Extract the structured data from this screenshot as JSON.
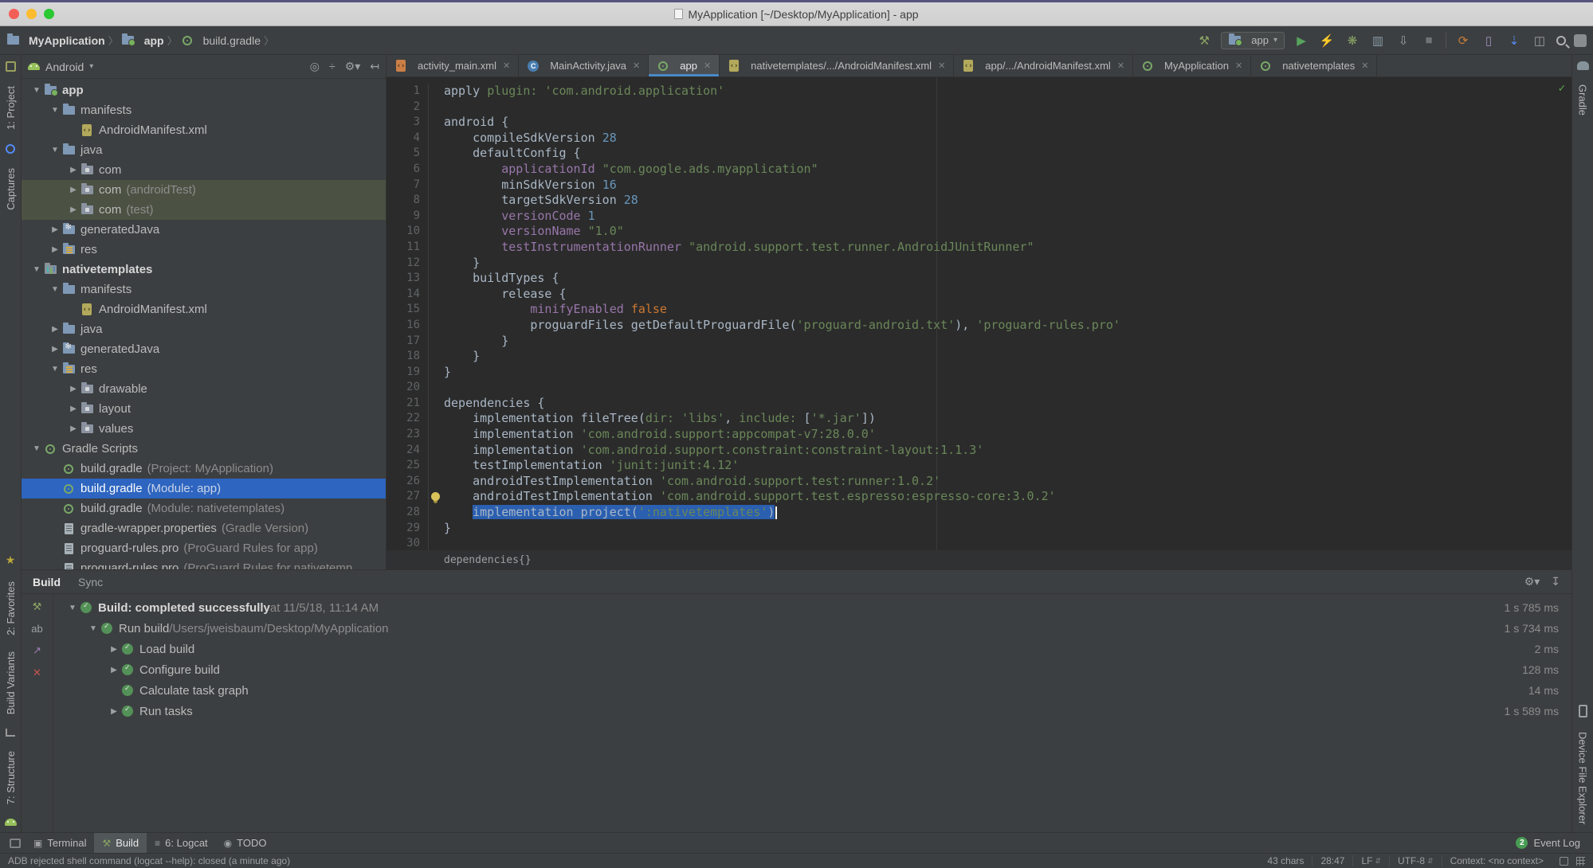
{
  "window": {
    "title": "MyApplication [~/Desktop/MyApplication] - app"
  },
  "breadcrumbs": {
    "items": [
      {
        "label": "MyApplication",
        "icon": "folder-icon",
        "bold": true
      },
      {
        "label": "app",
        "icon": "module-folder-icon",
        "bold": true
      },
      {
        "label": "build.gradle",
        "icon": "gradle-icon",
        "bold": false
      }
    ]
  },
  "toolbar": {
    "run_config": "app",
    "icons_left": [
      {
        "name": "build-hammer-icon",
        "glyph": "⚒",
        "color": "#8aa363"
      }
    ],
    "icons_run": [
      {
        "name": "run-icon",
        "glyph": "▶",
        "color": "#57a35c"
      },
      {
        "name": "apply-changes-icon",
        "glyph": "⚡",
        "color": "#a5a87b"
      },
      {
        "name": "debug-icon",
        "glyph": "❋",
        "color": "#8aa363"
      },
      {
        "name": "profiler-icon",
        "glyph": "▥",
        "color": "#8a9ba8"
      },
      {
        "name": "attach-debugger-icon",
        "glyph": "⇩",
        "color": "#9da0a2"
      },
      {
        "name": "stop-icon",
        "glyph": "■",
        "color": "#6f7375"
      }
    ],
    "icons_tools": [
      {
        "name": "sync-gradle-icon",
        "glyph": "⟳",
        "color": "#c77d3b"
      },
      {
        "name": "avd-manager-icon",
        "glyph": "▯",
        "color": "#9d8fc2"
      },
      {
        "name": "sdk-manager-icon",
        "glyph": "⇣",
        "color": "#548af7"
      },
      {
        "name": "layout-inspector-icon",
        "glyph": "◫",
        "color": "#9da0a2"
      }
    ]
  },
  "left_strip": {
    "top": [
      {
        "name": "tool-project",
        "label": "1: Project",
        "icon": "project-icon"
      },
      {
        "name": "tool-captures",
        "label": "Captures",
        "icon": "captures-icon"
      }
    ],
    "bottom": [
      {
        "name": "tool-favorites",
        "label": "2: Favorites",
        "icon": "star-icon"
      },
      {
        "name": "tool-build-variants",
        "label": "Build Variants",
        "icon": ""
      },
      {
        "name": "tool-structure",
        "label": "7: Structure",
        "icon": "structure-icon"
      }
    ]
  },
  "right_strip": {
    "top": [
      {
        "name": "tool-gradle",
        "label": "Gradle",
        "icon": "gradle-elephant-icon"
      }
    ],
    "bottom": [
      {
        "name": "tool-device-file-explorer",
        "label": "Device File Explorer",
        "icon": "device-icon"
      }
    ]
  },
  "project_panel": {
    "mode": "Android",
    "header_icons": [
      {
        "name": "locate-icon",
        "glyph": "◎"
      },
      {
        "name": "collapse-all-icon",
        "glyph": "÷"
      },
      {
        "name": "view-options-icon",
        "glyph": "⚙▾"
      },
      {
        "name": "hide-panel-icon",
        "glyph": "↤"
      }
    ],
    "tree": [
      {
        "depth": 0,
        "arrow": "open",
        "icon": "module-folder",
        "label": "app",
        "suffix": "",
        "bold": true
      },
      {
        "depth": 1,
        "arrow": "open",
        "icon": "folder",
        "label": "manifests",
        "suffix": ""
      },
      {
        "depth": 2,
        "arrow": "none",
        "icon": "xml-file",
        "label": "AndroidManifest.xml",
        "suffix": ""
      },
      {
        "depth": 1,
        "arrow": "open",
        "icon": "folder",
        "label": "java",
        "suffix": ""
      },
      {
        "depth": 2,
        "arrow": "closed",
        "icon": "package-folder",
        "label": "com",
        "suffix": ""
      },
      {
        "depth": 2,
        "arrow": "closed",
        "icon": "package-folder",
        "label": "com",
        "suffix": "(androidTest)",
        "band": true
      },
      {
        "depth": 2,
        "arrow": "closed",
        "icon": "package-folder",
        "label": "com",
        "suffix": "(test)",
        "band": true
      },
      {
        "depth": 1,
        "arrow": "closed",
        "icon": "gen-folder",
        "label": "generatedJava",
        "suffix": ""
      },
      {
        "depth": 1,
        "arrow": "closed",
        "icon": "res-folder",
        "label": "res",
        "suffix": ""
      },
      {
        "depth": 0,
        "arrow": "open",
        "icon": "lib-module",
        "label": "nativetemplates",
        "suffix": "",
        "bold": true
      },
      {
        "depth": 1,
        "arrow": "open",
        "icon": "folder",
        "label": "manifests",
        "suffix": ""
      },
      {
        "depth": 2,
        "arrow": "none",
        "icon": "xml-file",
        "label": "AndroidManifest.xml",
        "suffix": ""
      },
      {
        "depth": 1,
        "arrow": "closed",
        "icon": "folder",
        "label": "java",
        "suffix": ""
      },
      {
        "depth": 1,
        "arrow": "closed",
        "icon": "gen-folder",
        "label": "generatedJava",
        "suffix": ""
      },
      {
        "depth": 1,
        "arrow": "open",
        "icon": "res-folder",
        "label": "res",
        "suffix": ""
      },
      {
        "depth": 2,
        "arrow": "closed",
        "icon": "package-folder",
        "label": "drawable",
        "suffix": ""
      },
      {
        "depth": 2,
        "arrow": "closed",
        "icon": "package-folder",
        "label": "layout",
        "suffix": ""
      },
      {
        "depth": 2,
        "arrow": "closed",
        "icon": "package-folder",
        "label": "values",
        "suffix": ""
      },
      {
        "depth": 0,
        "arrow": "open",
        "icon": "gradle",
        "label": "Gradle Scripts",
        "suffix": ""
      },
      {
        "depth": 1,
        "arrow": "none",
        "icon": "gradle",
        "label": "build.gradle",
        "suffix": "(Project: MyApplication)"
      },
      {
        "depth": 1,
        "arrow": "none",
        "icon": "gradle",
        "label": "build.gradle",
        "suffix": "(Module: app)",
        "selected": true
      },
      {
        "depth": 1,
        "arrow": "none",
        "icon": "gradle",
        "label": "build.gradle",
        "suffix": "(Module: nativetemplates)"
      },
      {
        "depth": 1,
        "arrow": "none",
        "icon": "file",
        "label": "gradle-wrapper.properties",
        "suffix": "(Gradle Version)"
      },
      {
        "depth": 1,
        "arrow": "none",
        "icon": "file",
        "label": "proguard-rules.pro",
        "suffix": "(ProGuard Rules for app)"
      },
      {
        "depth": 1,
        "arrow": "none",
        "icon": "file",
        "label": "proguard-rules.pro",
        "suffix": "(ProGuard Rules for nativetemp"
      }
    ]
  },
  "tabs": [
    {
      "label": "activity_main.xml",
      "icon": "layout-xml"
    },
    {
      "label": "MainActivity.java",
      "icon": "java-class"
    },
    {
      "label": "app",
      "icon": "gradle",
      "selected": true
    },
    {
      "label": "nativetemplates/.../AndroidManifest.xml",
      "icon": "xml-file"
    },
    {
      "label": "app/.../AndroidManifest.xml",
      "icon": "xml-file"
    },
    {
      "label": "MyApplication",
      "icon": "gradle"
    },
    {
      "label": "nativetemplates",
      "icon": "gradle"
    }
  ],
  "editor": {
    "breadcrumb": "dependencies{}",
    "lines": [
      {
        "n": 1,
        "segs": [
          [
            "d",
            "apply "
          ],
          [
            "s",
            "plugin:"
          ],
          [
            "d",
            " "
          ],
          [
            "s",
            "'com.android.application'"
          ]
        ]
      },
      {
        "n": 2,
        "segs": []
      },
      {
        "n": 3,
        "segs": [
          [
            "d",
            "android {"
          ]
        ]
      },
      {
        "n": 4,
        "segs": [
          [
            "d",
            "    compileSdkVersion "
          ],
          [
            "n",
            "28"
          ]
        ]
      },
      {
        "n": 5,
        "segs": [
          [
            "d",
            "    defaultConfig {"
          ]
        ]
      },
      {
        "n": 6,
        "segs": [
          [
            "d",
            "        "
          ],
          [
            "p",
            "applicationId"
          ],
          [
            "d",
            " "
          ],
          [
            "s",
            "\"com.google.ads.myapplication\""
          ]
        ]
      },
      {
        "n": 7,
        "segs": [
          [
            "d",
            "        minSdkVersion "
          ],
          [
            "n",
            "16"
          ]
        ]
      },
      {
        "n": 8,
        "segs": [
          [
            "d",
            "        targetSdkVersion "
          ],
          [
            "n",
            "28"
          ]
        ]
      },
      {
        "n": 9,
        "segs": [
          [
            "d",
            "        "
          ],
          [
            "p",
            "versionCode"
          ],
          [
            "d",
            " "
          ],
          [
            "n",
            "1"
          ]
        ]
      },
      {
        "n": 10,
        "segs": [
          [
            "d",
            "        "
          ],
          [
            "p",
            "versionName"
          ],
          [
            "d",
            " "
          ],
          [
            "s",
            "\"1.0\""
          ]
        ]
      },
      {
        "n": 11,
        "segs": [
          [
            "d",
            "        "
          ],
          [
            "p",
            "testInstrumentationRunner"
          ],
          [
            "d",
            " "
          ],
          [
            "s",
            "\"android.support.test.runner.AndroidJUnitRunner\""
          ]
        ]
      },
      {
        "n": 12,
        "segs": [
          [
            "d",
            "    }"
          ]
        ]
      },
      {
        "n": 13,
        "segs": [
          [
            "d",
            "    buildTypes {"
          ]
        ]
      },
      {
        "n": 14,
        "segs": [
          [
            "d",
            "        release {"
          ]
        ]
      },
      {
        "n": 15,
        "segs": [
          [
            "d",
            "            "
          ],
          [
            "p",
            "minifyEnabled"
          ],
          [
            "d",
            " "
          ],
          [
            "k",
            "false"
          ]
        ]
      },
      {
        "n": 16,
        "segs": [
          [
            "d",
            "            proguardFiles getDefaultProguardFile("
          ],
          [
            "s",
            "'proguard-android.txt'"
          ],
          [
            "d",
            "), "
          ],
          [
            "s",
            "'proguard-rules.pro'"
          ]
        ]
      },
      {
        "n": 17,
        "segs": [
          [
            "d",
            "        }"
          ]
        ]
      },
      {
        "n": 18,
        "segs": [
          [
            "d",
            "    }"
          ]
        ]
      },
      {
        "n": 19,
        "segs": [
          [
            "d",
            "}"
          ]
        ]
      },
      {
        "n": 20,
        "segs": []
      },
      {
        "n": 21,
        "segs": [
          [
            "d",
            "dependencies {"
          ]
        ]
      },
      {
        "n": 22,
        "segs": [
          [
            "d",
            "    implementation fileTree("
          ],
          [
            "s",
            "dir:"
          ],
          [
            "d",
            " "
          ],
          [
            "s",
            "'libs'"
          ],
          [
            "d",
            ", "
          ],
          [
            "s",
            "include:"
          ],
          [
            "d",
            " ["
          ],
          [
            "s",
            "'*.jar'"
          ],
          [
            "d",
            "])"
          ]
        ]
      },
      {
        "n": 23,
        "segs": [
          [
            "d",
            "    implementation "
          ],
          [
            "s",
            "'com.android.support:appcompat-v7:28.0.0'"
          ]
        ]
      },
      {
        "n": 24,
        "segs": [
          [
            "d",
            "    implementation "
          ],
          [
            "s",
            "'com.android.support.constraint:constraint-layout:1.1.3'"
          ]
        ]
      },
      {
        "n": 25,
        "segs": [
          [
            "d",
            "    testImplementation "
          ],
          [
            "s",
            "'junit:junit:4.12'"
          ]
        ]
      },
      {
        "n": 26,
        "segs": [
          [
            "d",
            "    androidTestImplementation "
          ],
          [
            "s",
            "'com.android.support.test:runner:1.0.2'"
          ]
        ]
      },
      {
        "n": 27,
        "segs": [
          [
            "d",
            "    androidTestImplementation "
          ],
          [
            "s",
            "'com.android.support.test.espresso:espresso-core:3.0.2'"
          ]
        ],
        "bulb": true
      },
      {
        "n": 28,
        "segs": [
          [
            "d",
            "    "
          ]
        ],
        "sel": [
          [
            "d",
            "implementation project("
          ],
          [
            "s",
            "':nativetemplates'"
          ],
          [
            "d",
            ")"
          ]
        ],
        "cursor": true
      },
      {
        "n": 29,
        "segs": [
          [
            "d",
            "}"
          ]
        ]
      },
      {
        "n": 30,
        "segs": []
      }
    ]
  },
  "build_panel": {
    "tabs": [
      {
        "label": "Build",
        "selected": true
      },
      {
        "label": "Sync",
        "selected": false
      }
    ],
    "header_icons": [
      {
        "name": "build-settings-icon",
        "glyph": "⚙▾"
      },
      {
        "name": "collapse-panel-icon",
        "glyph": "↧"
      }
    ],
    "toolbar_icons": [
      {
        "name": "restart-build-icon",
        "glyph": "⚒",
        "color": "#8aa363"
      },
      {
        "name": "filter-text-icon",
        "glyph": "ab",
        "color": "#9da0a2"
      },
      {
        "name": "export-icon",
        "glyph": "↗",
        "color": "#9b7cb6"
      },
      {
        "name": "close-icon",
        "glyph": "✕",
        "color": "#c75450"
      }
    ],
    "rows": [
      {
        "depth": 0,
        "arrow": "open",
        "parts": [
          [
            "b",
            "Build: completed successfully"
          ],
          [
            "g",
            " at 11/5/18, 11:14 AM"
          ]
        ],
        "time": "1 s 785 ms"
      },
      {
        "depth": 1,
        "arrow": "open",
        "parts": [
          [
            "w",
            "Run build "
          ],
          [
            "g",
            "/Users/jweisbaum/Desktop/MyApplication"
          ]
        ],
        "time": "1 s 734 ms"
      },
      {
        "depth": 2,
        "arrow": "closed",
        "parts": [
          [
            "w",
            "Load build"
          ]
        ],
        "time": "2 ms"
      },
      {
        "depth": 2,
        "arrow": "closed",
        "parts": [
          [
            "w",
            "Configure build"
          ]
        ],
        "time": "128 ms"
      },
      {
        "depth": 2,
        "arrow": "none",
        "parts": [
          [
            "w",
            "Calculate task graph"
          ]
        ],
        "time": "14 ms"
      },
      {
        "depth": 2,
        "arrow": "closed",
        "parts": [
          [
            "w",
            "Run tasks"
          ]
        ],
        "time": "1 s 589 ms"
      }
    ]
  },
  "bottom_bar": {
    "items": [
      {
        "label": "Terminal",
        "icon": "terminal-icon",
        "selected": false
      },
      {
        "label": "Build",
        "icon": "hammer-icon",
        "selected": true
      },
      {
        "label": "6: Logcat",
        "icon": "logcat-icon",
        "selected": false
      },
      {
        "label": "TODO",
        "icon": "todo-icon",
        "selected": false
      }
    ],
    "event_log": {
      "badge": "2",
      "label": "Event Log"
    }
  },
  "status_bar": {
    "message": "ADB rejected shell command (logcat --help): closed (a minute ago)",
    "right": [
      {
        "label": "43 chars",
        "chevron": false
      },
      {
        "label": "28:47",
        "chevron": false
      },
      {
        "label": "LF",
        "chevron": true
      },
      {
        "label": "UTF-8",
        "chevron": true
      },
      {
        "label": "Context: <no context>",
        "chevron": false
      }
    ]
  }
}
